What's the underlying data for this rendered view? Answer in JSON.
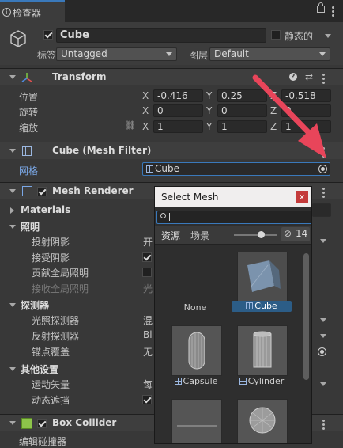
{
  "tab": {
    "title": "检查器"
  },
  "object": {
    "name": "Cube",
    "static_label": "静态的",
    "tag_label": "标签",
    "tag_value": "Untagged",
    "layer_label": "图层",
    "layer_value": "Default"
  },
  "transform": {
    "title": "Transform",
    "position_label": "位置",
    "rotation_label": "旋转",
    "scale_label": "缩放",
    "axis_x": "X",
    "axis_y": "Y",
    "axis_z": "Z",
    "position": {
      "x": "-0.416",
      "y": "0.25",
      "z": "-0.518"
    },
    "rotation": {
      "x": "0",
      "y": "0",
      "z": "0"
    },
    "scale": {
      "x": "1",
      "y": "1",
      "z": "1"
    }
  },
  "mesh_filter": {
    "title": "Cube (Mesh Filter)",
    "mesh_label": "网格",
    "mesh_value": "Cube"
  },
  "mesh_renderer": {
    "title": "Mesh Renderer",
    "materials": "Materials",
    "lighting": "照明",
    "cast_shadows": "投射阴影",
    "cast_shadows_value": "开",
    "receive_shadows": "接受阴影",
    "contribute_gi": "贡献全局照明",
    "receive_gi": "接收全局照明",
    "receive_gi_value": "光",
    "probes": "探测器",
    "light_probes": "光照探测器",
    "light_probes_value": "混",
    "reflection_probes": "反射探测器",
    "reflection_probes_value": "Bl",
    "anchor_override": "锚点覆盖",
    "anchor_override_value": "无",
    "other": "其他设置",
    "motion_vectors": "运动矢量",
    "motion_vectors_value": "每",
    "dynamic_occlusion": "动态遮挡"
  },
  "box_collider": {
    "title": "Box Collider",
    "edit_collider": "编辑碰撞器"
  },
  "popup": {
    "title": "Select Mesh",
    "close": "x",
    "tab_assets": "资源",
    "tab_scene": "场景",
    "hidden_count": "14",
    "items": [
      {
        "label": "None"
      },
      {
        "label": "Cube"
      },
      {
        "label": "Capsule"
      },
      {
        "label": "Cylinder"
      }
    ]
  },
  "colors": {
    "accent": "#3a79bb",
    "selection": "#2c5d87",
    "arrow": "#e8455a"
  }
}
